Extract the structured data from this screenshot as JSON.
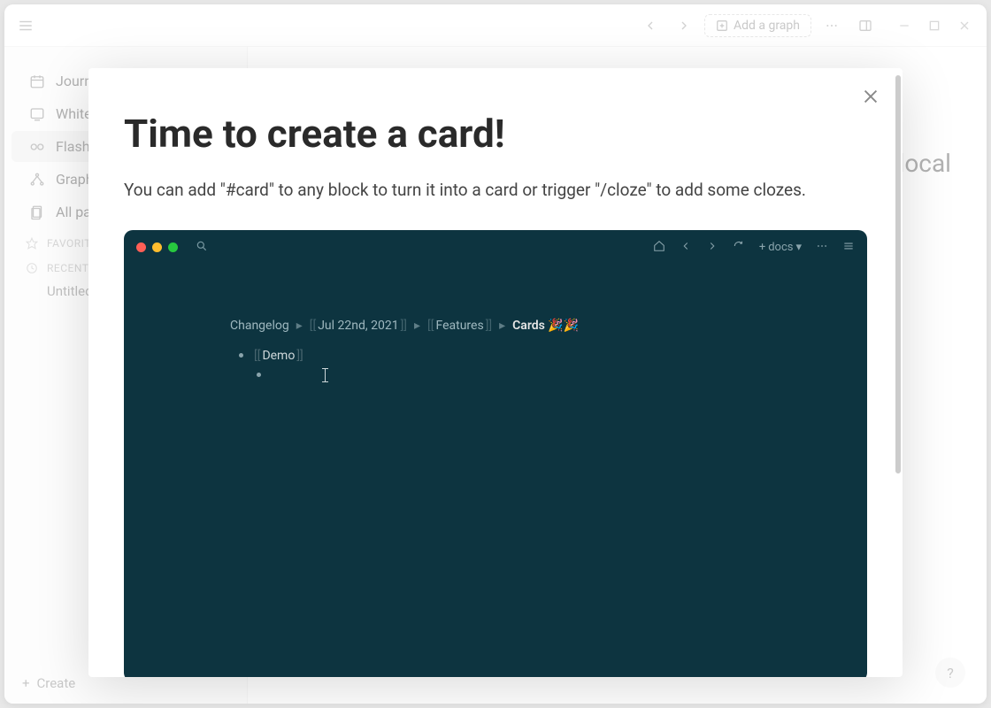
{
  "titlebar": {
    "add_graph_label": "Add a graph"
  },
  "sidebar": {
    "items": [
      {
        "label": "Journals"
      },
      {
        "label": "Whiteboards"
      },
      {
        "label": "Flashcards"
      },
      {
        "label": "Graph view"
      },
      {
        "label": "All pages"
      }
    ],
    "favorites_label": "FAVORITES",
    "recent_label": "RECENT",
    "recent_items": [
      {
        "label": "Untitled"
      }
    ],
    "create_label": "Create"
  },
  "main": {
    "partial_title_right": "local",
    "help_label": "?"
  },
  "modal": {
    "title": "Time to create a card!",
    "description": "You can add \"#card\" to any block to turn it into a card or trigger \"/cloze\" to add some clozes."
  },
  "demo": {
    "docs_label": "docs",
    "breadcrumb": [
      {
        "text": "Changelog",
        "kind": "plain"
      },
      {
        "text": "Jul 22nd, 2021",
        "kind": "link"
      },
      {
        "text": "Features",
        "kind": "link"
      },
      {
        "text": "Cards 🎉🎉",
        "kind": "final"
      }
    ],
    "bullets": [
      {
        "text": "Demo",
        "kind": "link"
      }
    ]
  }
}
